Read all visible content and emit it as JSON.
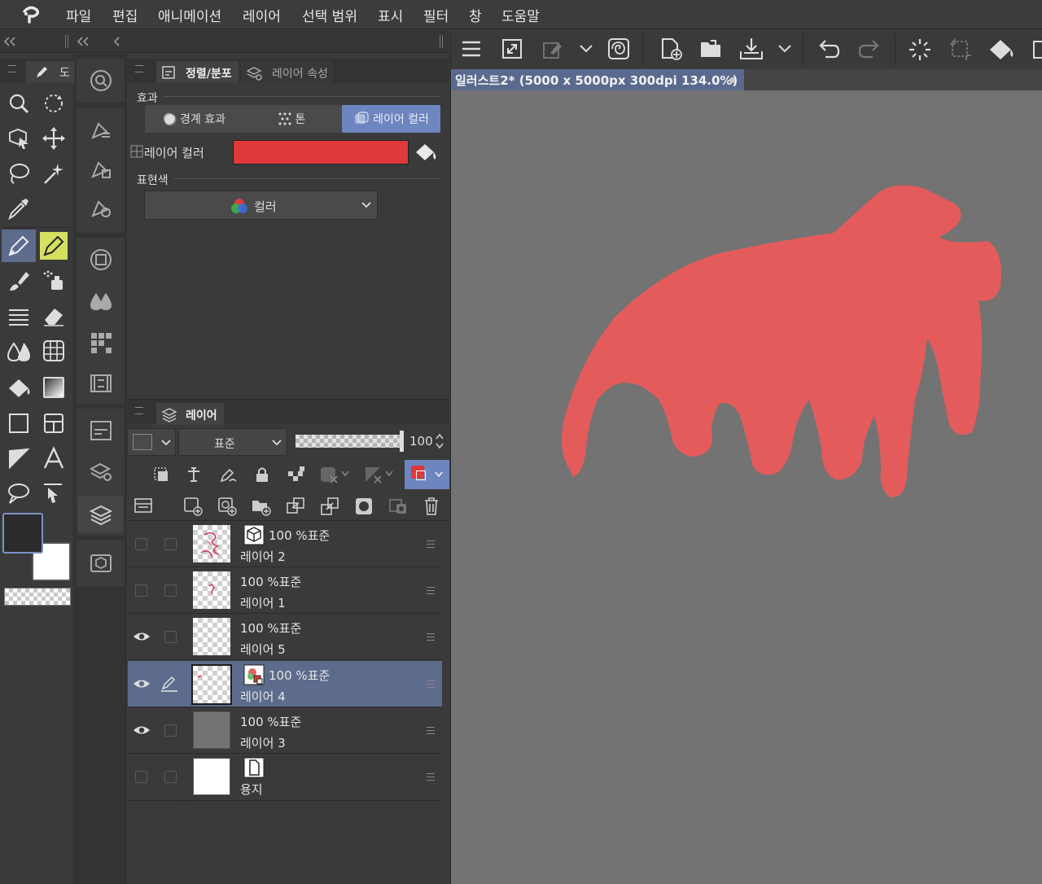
{
  "menu": [
    "파일",
    "편집",
    "애니메이션",
    "레이어",
    "선택 범위",
    "표시",
    "필터",
    "창",
    "도움말"
  ],
  "tool_panel": {
    "tab_label": "도"
  },
  "props_panel": {
    "tabs": [
      {
        "label": "정렬/분포"
      },
      {
        "label": "레이어 속성"
      }
    ],
    "effect_label": "효과",
    "effect_buttons": [
      "경계 효과",
      "톤",
      "레이어 컬러"
    ],
    "layer_color_label": "레이어 컬러",
    "layer_color_value": "#e0393b",
    "expression_label": "표현색",
    "expression_value": "컬러"
  },
  "layer_panel": {
    "tab_label": "레이어",
    "blend_mode": "표준",
    "opacity": "100",
    "layers": [
      {
        "opacity_mode": "100 %표준",
        "name": "레이어 2",
        "visible": false
      },
      {
        "opacity_mode": "100 %표준",
        "name": "레이어 1",
        "visible": false
      },
      {
        "opacity_mode": "100 %표준",
        "name": "레이어 5",
        "visible": true
      },
      {
        "opacity_mode": "100 %표준",
        "name": "레이어 4",
        "visible": true,
        "selected": true
      },
      {
        "opacity_mode": "100 %표준",
        "name": "레이어 3",
        "visible": true
      },
      {
        "opacity_mode": "",
        "name": "용지",
        "visible": false
      }
    ]
  },
  "canvas": {
    "tab_title": "일러스트2* (5000 x 5000px 300dpi 134.0%)",
    "background": "#737373",
    "shape_color": "#e45b5b"
  },
  "colors": {
    "accent": "#6d86bf",
    "selected_row": "#5d6b8c",
    "main_color": "#2b2b2b",
    "sub_color": "#ffffff"
  }
}
